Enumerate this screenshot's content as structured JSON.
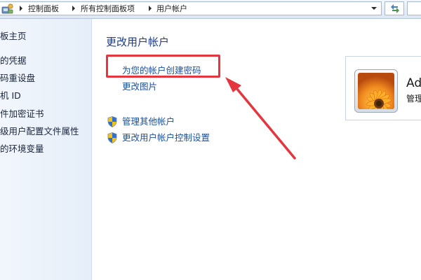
{
  "address_bar": {
    "crumbs": [
      "控制面板",
      "所有控制面板项",
      "用户帐户"
    ]
  },
  "left_nav": {
    "items": [
      "板主页",
      "的凭据",
      "码重设盘",
      "机 ID",
      "件加密证书",
      "级用户配置文件属性",
      "的环境变量"
    ]
  },
  "main": {
    "title": "更改用户帐户",
    "links": {
      "create_password": "为您的帐户创建密码",
      "change_picture": "更改图片",
      "manage_accounts": "管理其他帐户",
      "uac_settings": "更改用户帐户控制设置"
    }
  },
  "user_tile": {
    "name": "Ad",
    "role": "管理"
  },
  "colors": {
    "highlight": "#e3363f",
    "link": "#1c4f9c",
    "title": "#1e3a8a"
  }
}
